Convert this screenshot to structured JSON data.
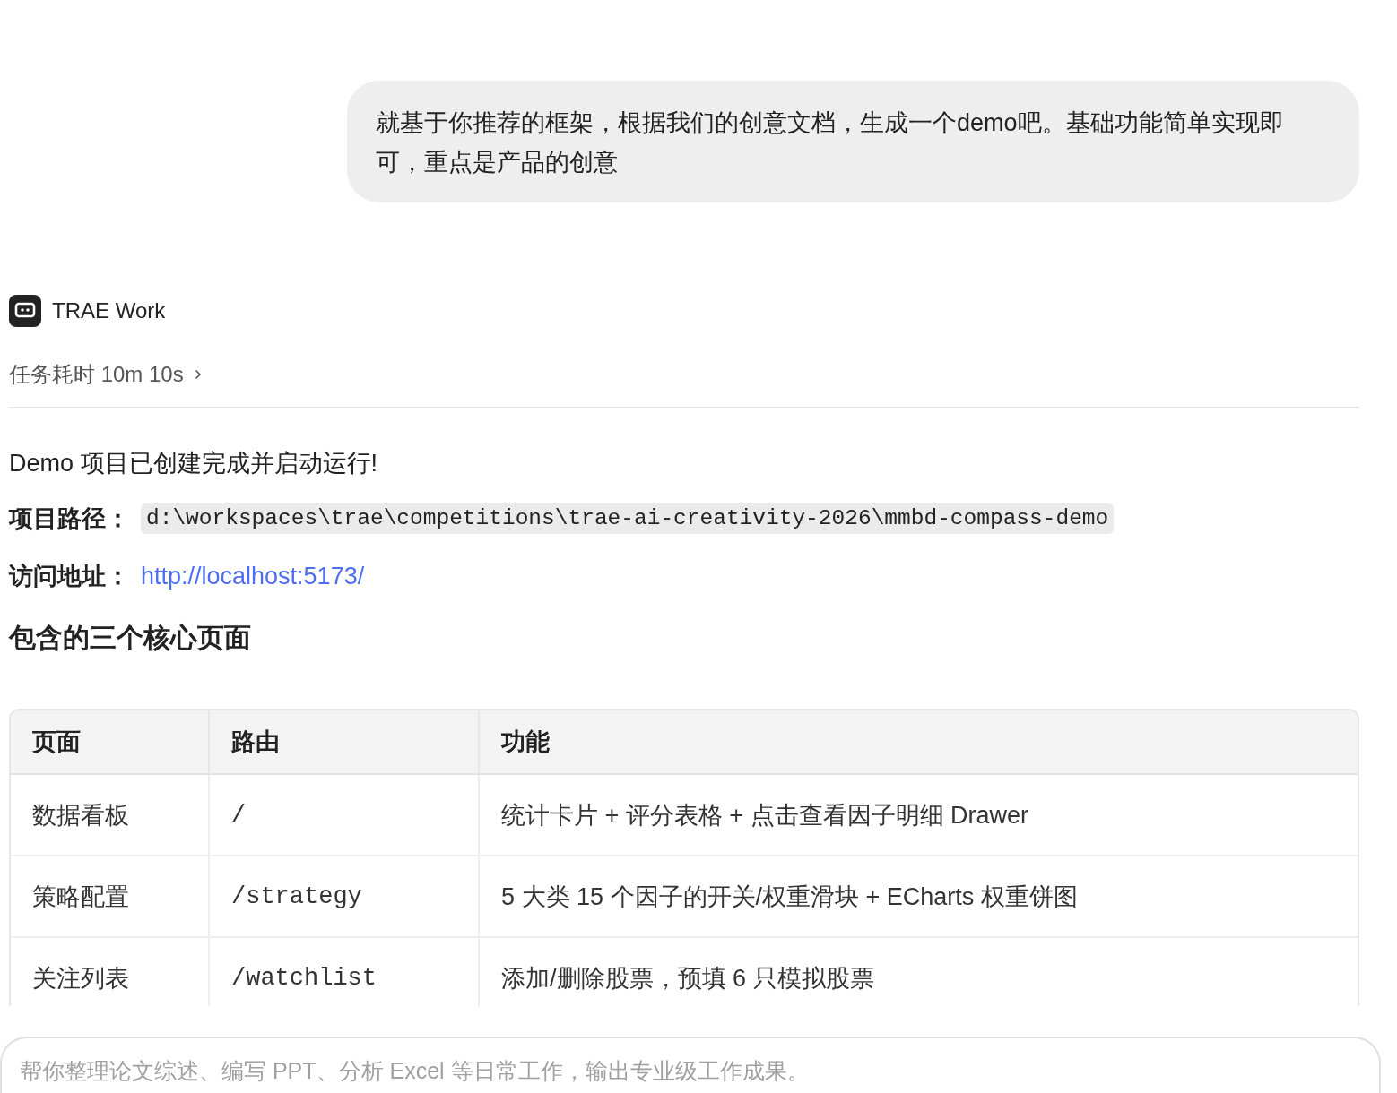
{
  "user_message": {
    "text": "就基于你推荐的框架，根据我们的创意文档，生成一个demo吧。基础功能简单实现即可，重点是产品的创意"
  },
  "assistant": {
    "name": "TRAE Work",
    "duration": "任务耗时 10m 10s",
    "summary": "Demo 项目已创建完成并启动运行!",
    "fields": [
      {
        "label": "项目路径：",
        "kind": "code",
        "value": "d:\\workspaces\\trae\\competitions\\trae-ai-creativity-2026\\mmbd-compass-demo"
      },
      {
        "label": "访问地址：",
        "kind": "link",
        "value": "http://localhost:5173/"
      }
    ],
    "heading": "包含的三个核心页面",
    "table": {
      "columns": [
        {
          "label": "页面",
          "kind": "text"
        },
        {
          "label": "路由",
          "kind": "code"
        },
        {
          "label": "功能",
          "kind": "text"
        }
      ],
      "rows": [
        [
          "数据看板",
          "/",
          "统计卡片 + 评分表格 + 点击查看因子明细 Drawer"
        ],
        [
          "策略配置",
          "/strategy",
          "5 大类 15 个因子的开关/权重滑块 + ECharts 权重饼图"
        ],
        [
          "关注列表",
          "/watchlist",
          "添加/删除股票，预填 6 只模拟股票"
        ]
      ]
    }
  },
  "composer": {
    "placeholder": "帮你整理论文综述、编写 PPT、分析 Excel 等日常工作，输出专业级工作成果。"
  }
}
